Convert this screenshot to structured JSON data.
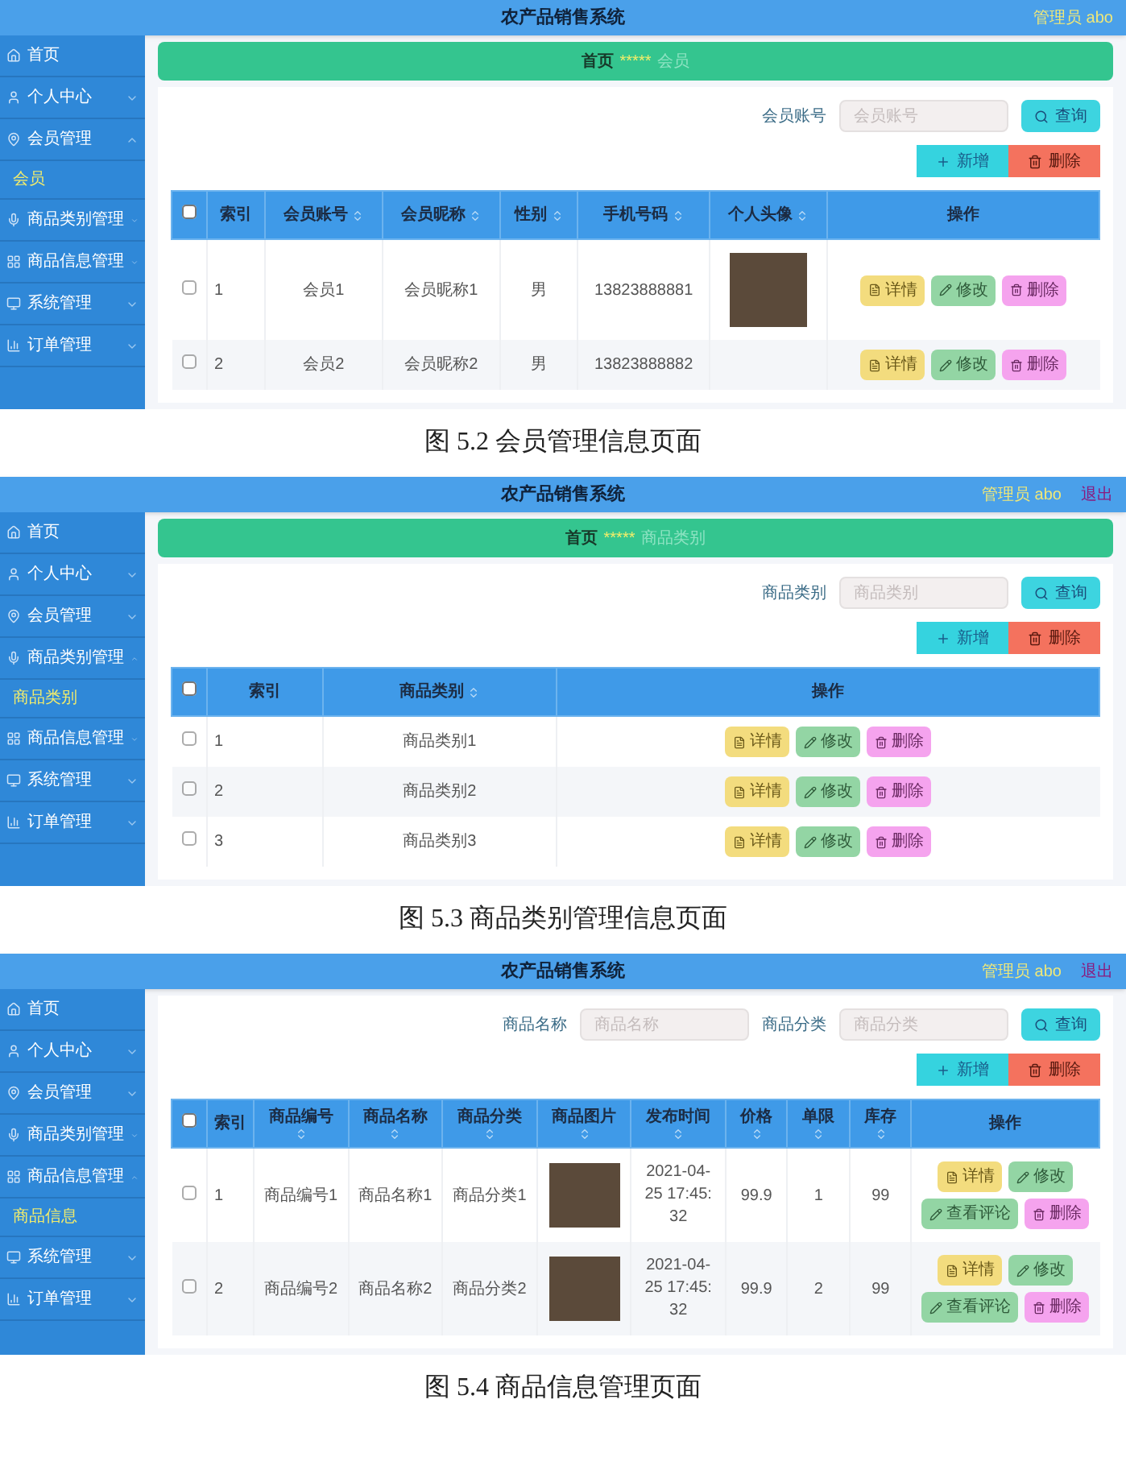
{
  "figures": [
    {
      "header": {
        "title": "农产品销售系统",
        "user": "管理员 abo"
      },
      "sidebar": [
        {
          "label": "首页"
        },
        {
          "label": "个人中心",
          "expanded": false
        },
        {
          "label": "会员管理",
          "expanded": true,
          "children": [
            {
              "label": "会员",
              "selected": true
            }
          ]
        },
        {
          "label": "商品类别管理",
          "expanded": false
        },
        {
          "label": "商品信息管理",
          "expanded": false
        },
        {
          "label": "系统管理",
          "expanded": false
        },
        {
          "label": "订单管理",
          "expanded": false
        }
      ],
      "breadcrumb": {
        "home": "首页",
        "separator": "*****",
        "current": "会员"
      },
      "filters": [
        {
          "label": "会员账号",
          "placeholder": "会员账号"
        }
      ],
      "search_button": "查询",
      "toolbar": [
        {
          "kind": "add",
          "label": "新增"
        },
        {
          "kind": "delete",
          "label": "删除"
        }
      ],
      "table": {
        "header_checked": false,
        "columns": [
          {
            "label": "索引",
            "sortable": false
          },
          {
            "label": "会员账号",
            "sortable": true
          },
          {
            "label": "会员昵称",
            "sortable": true
          },
          {
            "label": "性别",
            "sortable": true
          },
          {
            "label": "手机号码",
            "sortable": true
          },
          {
            "label": "个人头像",
            "sortable": true
          },
          {
            "label": "操作",
            "sortable": false
          }
        ],
        "rows": [
          {
            "checked": false,
            "cells": [
              {
                "kind": "text",
                "text": "1"
              },
              {
                "kind": "text",
                "text": "会员1"
              },
              {
                "kind": "text",
                "text": "会员昵称1"
              },
              {
                "kind": "text",
                "text": "男"
              },
              {
                "kind": "text",
                "text": "13823888881"
              },
              {
                "kind": "photo"
              }
            ],
            "actions": [
              {
                "kind": "detail",
                "label": "详情"
              },
              {
                "kind": "edit",
                "label": "修改"
              },
              {
                "kind": "remove",
                "label": "删除"
              }
            ]
          },
          {
            "checked": false,
            "cells": [
              {
                "kind": "text",
                "text": "2"
              },
              {
                "kind": "text",
                "text": "会员2"
              },
              {
                "kind": "text",
                "text": "会员昵称2"
              },
              {
                "kind": "text",
                "text": "男"
              },
              {
                "kind": "text",
                "text": "13823888882"
              },
              {
                "kind": "empty"
              }
            ],
            "actions": [
              {
                "kind": "detail",
                "label": "详情"
              },
              {
                "kind": "edit",
                "label": "修改"
              },
              {
                "kind": "remove",
                "label": "删除"
              }
            ]
          }
        ]
      },
      "caption": "图 5.2 会员管理信息页面"
    },
    {
      "header": {
        "title": "农产品销售系统",
        "user": "管理员 abo",
        "logout": "退出"
      },
      "sidebar": [
        {
          "label": "首页"
        },
        {
          "label": "个人中心",
          "expanded": false
        },
        {
          "label": "会员管理",
          "expanded": false
        },
        {
          "label": "商品类别管理",
          "expanded": true,
          "children": [
            {
              "label": "商品类别",
              "selected": true
            }
          ]
        },
        {
          "label": "商品信息管理",
          "expanded": false
        },
        {
          "label": "系统管理",
          "expanded": false
        },
        {
          "label": "订单管理",
          "expanded": false
        }
      ],
      "breadcrumb": {
        "home": "首页",
        "separator": "*****",
        "current": "商品类别"
      },
      "filters": [
        {
          "label": "商品类别",
          "placeholder": "商品类别"
        }
      ],
      "search_button": "查询",
      "toolbar": [
        {
          "kind": "add",
          "label": "新增"
        },
        {
          "kind": "delete",
          "label": "删除"
        }
      ],
      "table": {
        "header_checked": false,
        "columns": [
          {
            "label": "索引",
            "sortable": false
          },
          {
            "label": "商品类别",
            "sortable": true
          },
          {
            "label": "操作",
            "sortable": false
          }
        ],
        "rows": [
          {
            "checked": false,
            "cells": [
              {
                "kind": "text",
                "text": "1"
              },
              {
                "kind": "text",
                "text": "商品类别1"
              }
            ],
            "actions": [
              {
                "kind": "detail",
                "label": "详情"
              },
              {
                "kind": "edit",
                "label": "修改"
              },
              {
                "kind": "remove",
                "label": "删除"
              }
            ]
          },
          {
            "checked": false,
            "cells": [
              {
                "kind": "text",
                "text": "2"
              },
              {
                "kind": "text",
                "text": "商品类别2"
              }
            ],
            "actions": [
              {
                "kind": "detail",
                "label": "详情"
              },
              {
                "kind": "edit",
                "label": "修改"
              },
              {
                "kind": "remove",
                "label": "删除"
              }
            ]
          },
          {
            "checked": false,
            "cells": [
              {
                "kind": "text",
                "text": "3"
              },
              {
                "kind": "text",
                "text": "商品类别3"
              }
            ],
            "actions": [
              {
                "kind": "detail",
                "label": "详情"
              },
              {
                "kind": "edit",
                "label": "修改"
              },
              {
                "kind": "remove",
                "label": "删除"
              }
            ]
          }
        ]
      },
      "caption": "图 5.3 商品类别管理信息页面"
    },
    {
      "header": {
        "title": "农产品销售系统",
        "user": "管理员 abo",
        "logout": "退出"
      },
      "sidebar": [
        {
          "label": "首页"
        },
        {
          "label": "个人中心",
          "expanded": false
        },
        {
          "label": "会员管理",
          "expanded": false
        },
        {
          "label": "商品类别管理",
          "expanded": false
        },
        {
          "label": "商品信息管理",
          "expanded": true,
          "children": [
            {
              "label": "商品信息",
              "selected": true
            }
          ]
        },
        {
          "label": "系统管理",
          "expanded": false
        },
        {
          "label": "订单管理",
          "expanded": false
        }
      ],
      "filters": [
        {
          "label": "商品名称",
          "placeholder": "商品名称"
        },
        {
          "label": "商品分类",
          "placeholder": "商品分类"
        }
      ],
      "search_button": "查询",
      "toolbar": [
        {
          "kind": "add",
          "label": "新增"
        },
        {
          "kind": "delete",
          "label": "删除"
        }
      ],
      "table": {
        "header_checked": false,
        "columns": [
          {
            "label": "索引",
            "sortable": false
          },
          {
            "label": "商品编号",
            "sortable": true
          },
          {
            "label": "商品名称",
            "sortable": true
          },
          {
            "label": "商品分类",
            "sortable": true
          },
          {
            "label": "商品图片",
            "sortable": true
          },
          {
            "label": "发布时间",
            "sortable": true
          },
          {
            "label": "价格",
            "sortable": true
          },
          {
            "label": "单限",
            "sortable": true
          },
          {
            "label": "库存",
            "sortable": true
          },
          {
            "label": "操作",
            "sortable": false
          }
        ],
        "rows": [
          {
            "checked": false,
            "cells": [
              {
                "kind": "text",
                "text": "1"
              },
              {
                "kind": "text",
                "text": "商品编号1"
              },
              {
                "kind": "text",
                "text": "商品名称1"
              },
              {
                "kind": "text",
                "text": "商品分类1"
              },
              {
                "kind": "photo"
              },
              {
                "kind": "date",
                "text": "2021-04-25 17:45:32"
              },
              {
                "kind": "text",
                "text": "99.9"
              },
              {
                "kind": "text",
                "text": "1"
              },
              {
                "kind": "text",
                "text": "99"
              }
            ],
            "actions": [
              {
                "kind": "detail",
                "label": "详情"
              },
              {
                "kind": "edit",
                "label": "修改"
              },
              {
                "kind": "review",
                "label": "查看评论"
              },
              {
                "kind": "remove",
                "label": "删除"
              }
            ]
          },
          {
            "checked": false,
            "cells": [
              {
                "kind": "text",
                "text": "2"
              },
              {
                "kind": "text",
                "text": "商品编号2"
              },
              {
                "kind": "text",
                "text": "商品名称2"
              },
              {
                "kind": "text",
                "text": "商品分类2"
              },
              {
                "kind": "photo"
              },
              {
                "kind": "date",
                "text": "2021-04-25 17:45:32"
              },
              {
                "kind": "text",
                "text": "99.9"
              },
              {
                "kind": "text",
                "text": "2"
              },
              {
                "kind": "text",
                "text": "99"
              }
            ],
            "actions": [
              {
                "kind": "detail",
                "label": "详情"
              },
              {
                "kind": "edit",
                "label": "修改"
              },
              {
                "kind": "review",
                "label": "查看评论"
              },
              {
                "kind": "remove",
                "label": "删除"
              }
            ]
          }
        ]
      },
      "caption": "图 5.4 商品信息管理页面"
    }
  ]
}
